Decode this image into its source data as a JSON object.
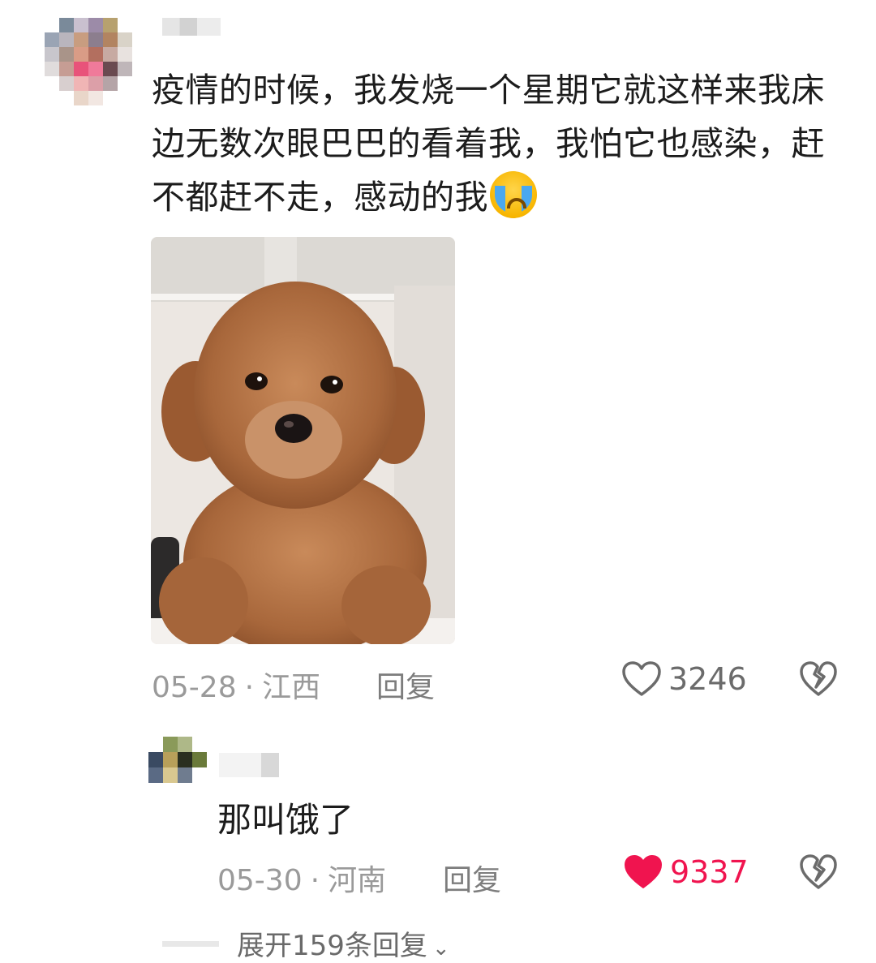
{
  "comment": {
    "text": "疫情的时候，我发烧一个星期它就这样来我床边无数次眼巴巴的看着我，我怕它也感染，赶不都赶不走，感动的我",
    "emoji": "loudly-crying-face",
    "photo_subject": "brown-toy-poodle-photo",
    "date": "05-28",
    "separator": "·",
    "location": "江西",
    "reply_label": "回复",
    "like_count": "3246",
    "liked": false
  },
  "reply": {
    "text": "那叫饿了",
    "date": "05-30",
    "separator": "·",
    "location": "河南",
    "reply_label": "回复",
    "like_count": "9337",
    "liked": true
  },
  "expand": {
    "label": "展开159条回复",
    "icon": "chevron-down-icon"
  },
  "colors": {
    "liked": "#f0144f",
    "meta": "#9a9a9a",
    "text": "#1c1c1c"
  }
}
